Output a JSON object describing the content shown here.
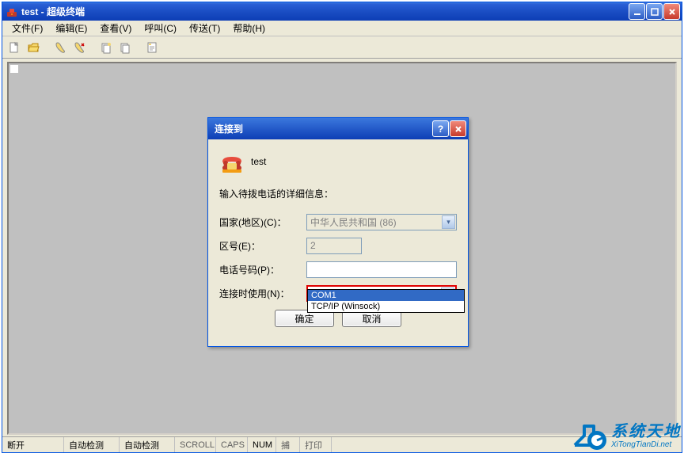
{
  "window": {
    "title": "test - 超级终端"
  },
  "menu": {
    "file": "文件(F)",
    "edit": "编辑(E)",
    "view": "查看(V)",
    "call": "呼叫(C)",
    "transfer": "传送(T)",
    "help": "帮助(H)"
  },
  "dialog": {
    "title": "连接到",
    "connection_name": "test",
    "instruction": "输入待拨电话的详细信息：",
    "country_label": "国家(地区)(C)：",
    "country_value": "中华人民共和国 (86)",
    "area_label": "区号(E)：",
    "area_value": "2",
    "phone_label": "电话号码(P)：",
    "phone_value": "",
    "connect_label": "连接时使用(N)：",
    "connect_value": "COM1",
    "ok": "确定",
    "cancel": "取消"
  },
  "dropdown": {
    "items": [
      "COM1",
      "TCP/IP (Winsock)"
    ]
  },
  "statusbar": {
    "disconnected": "断开",
    "auto1": "自动检测",
    "auto2": "自动检测",
    "scroll": "SCROLL",
    "caps": "CAPS",
    "num": "NUM",
    "capture": "捕",
    "print": "打印"
  },
  "watermark": {
    "title": "系统天地",
    "url": "XiTongTianDi.net"
  }
}
